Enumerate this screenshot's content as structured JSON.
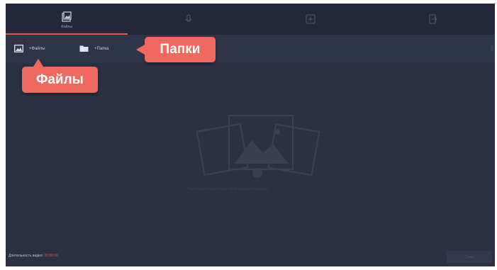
{
  "tabs": [
    {
      "label": "Файлы",
      "icon": "files-icon",
      "active": true
    },
    {
      "label": "",
      "icon": "microphone-icon",
      "active": false
    },
    {
      "label": "",
      "icon": "add-icon",
      "active": false
    },
    {
      "label": "",
      "icon": "export-icon",
      "active": false
    }
  ],
  "toolbar": {
    "add_files": "+Файлы",
    "add_folder": "+Папка"
  },
  "empty_state": {
    "hint": "Перетащите файлы или папки сюда или нажмите"
  },
  "footer": {
    "duration_label": "Длительность видео:",
    "duration_value": "00:00:00",
    "convert_label": "Старт"
  },
  "callouts": {
    "folders": "Папки",
    "files": "Файлы"
  },
  "colors": {
    "accent": "#e85c50",
    "callout": "#ef6a5e",
    "background": "#2b3042",
    "tabbar": "#22273a"
  }
}
